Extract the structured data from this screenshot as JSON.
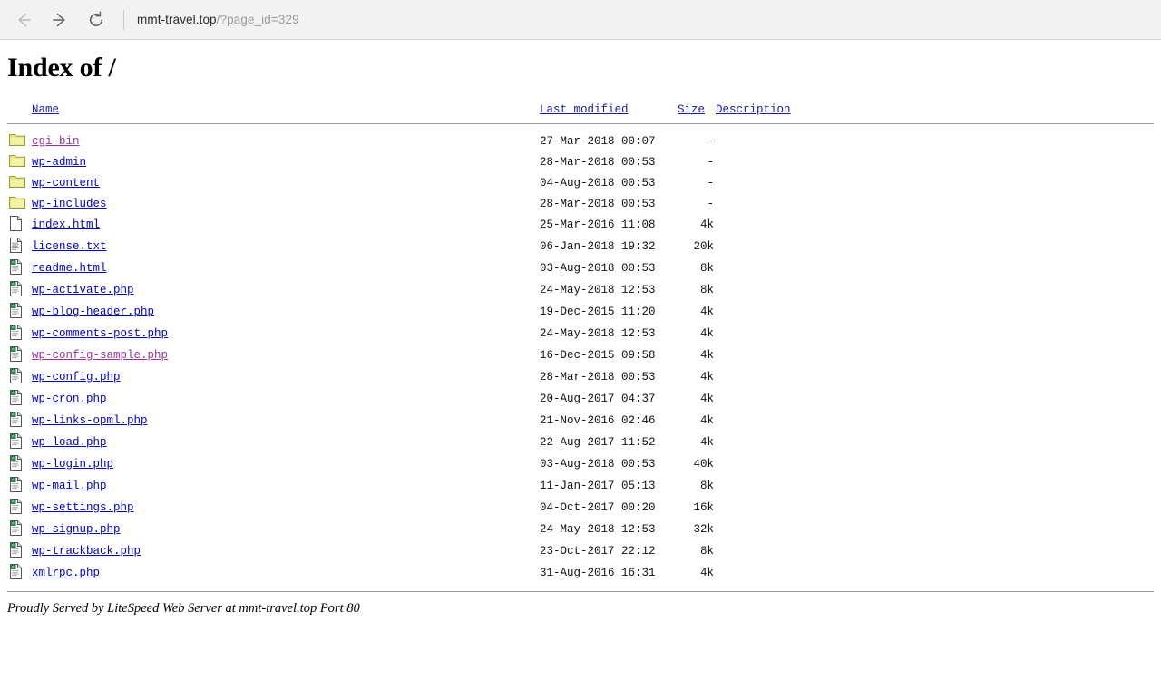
{
  "browser": {
    "back_icon": "arrow-left-icon",
    "forward_icon": "arrow-right-icon",
    "reload_icon": "reload-icon",
    "url_host": "mmt-travel.top",
    "url_path": "/?page_id=329"
  },
  "page": {
    "title": "Index of /",
    "columns": {
      "name": "Name",
      "last_modified": "Last modified",
      "size": "Size",
      "description": "Description "
    },
    "footer": "Proudly Served by LiteSpeed Web Server at mmt-travel.top Port 80"
  },
  "colors": {
    "link": "#0000cc",
    "visited_link": "#993399",
    "folder": "#efef9f",
    "rule": "#9a9a9a"
  },
  "entries": [
    {
      "icon": "folder-icon",
      "name": "cgi-bin",
      "modified": "27-Mar-2018 00:07",
      "size": "-",
      "visited": true
    },
    {
      "icon": "folder-icon",
      "name": "wp-admin",
      "modified": "28-Mar-2018 00:53",
      "size": "-",
      "visited": false
    },
    {
      "icon": "folder-icon",
      "name": "wp-content",
      "modified": "04-Aug-2018 00:53",
      "size": "-",
      "visited": false
    },
    {
      "icon": "folder-icon",
      "name": "wp-includes",
      "modified": "28-Mar-2018 00:53",
      "size": "-",
      "visited": false
    },
    {
      "icon": "blank-page-icon",
      "name": "index.html ",
      "modified": "25-Mar-2016 11:08",
      "size": "4k",
      "visited": false
    },
    {
      "icon": "text-file-icon",
      "name": "license.txt",
      "modified": "06-Jan-2018 19:32",
      "size": "20k",
      "visited": false
    },
    {
      "icon": "script-file-icon",
      "name": "readme.html",
      "modified": "03-Aug-2018 00:53",
      "size": "8k",
      "visited": false
    },
    {
      "icon": "script-file-icon",
      "name": "wp-activate.php",
      "modified": "24-May-2018 12:53",
      "size": "8k",
      "visited": false
    },
    {
      "icon": "script-file-icon",
      "name": "wp-blog-header.php",
      "modified": "19-Dec-2015 11:20",
      "size": "4k",
      "visited": false
    },
    {
      "icon": "script-file-icon",
      "name": "wp-comments-post.php",
      "modified": "24-May-2018 12:53",
      "size": "4k",
      "visited": false
    },
    {
      "icon": "script-file-icon",
      "name": "wp-config-sample.php",
      "modified": "16-Dec-2015 09:58",
      "size": "4k",
      "visited": true
    },
    {
      "icon": "script-file-icon",
      "name": "wp-config.php",
      "modified": "28-Mar-2018 00:53",
      "size": "4k",
      "visited": false
    },
    {
      "icon": "script-file-icon",
      "name": "wp-cron.php",
      "modified": "20-Aug-2017 04:37",
      "size": "4k",
      "visited": false
    },
    {
      "icon": "script-file-icon",
      "name": "wp-links-opml.php",
      "modified": "21-Nov-2016 02:46",
      "size": "4k",
      "visited": false
    },
    {
      "icon": "script-file-icon",
      "name": "wp-load.php",
      "modified": "22-Aug-2017 11:52",
      "size": "4k",
      "visited": false
    },
    {
      "icon": "script-file-icon",
      "name": "wp-login.php",
      "modified": "03-Aug-2018 00:53",
      "size": "40k",
      "visited": false
    },
    {
      "icon": "script-file-icon",
      "name": "wp-mail.php",
      "modified": "11-Jan-2017 05:13",
      "size": "8k",
      "visited": false
    },
    {
      "icon": "script-file-icon",
      "name": "wp-settings.php",
      "modified": "04-Oct-2017 00:20",
      "size": "16k",
      "visited": false
    },
    {
      "icon": "script-file-icon",
      "name": "wp-signup.php",
      "modified": "24-May-2018 12:53",
      "size": "32k",
      "visited": false
    },
    {
      "icon": "script-file-icon",
      "name": "wp-trackback.php",
      "modified": "23-Oct-2017 22:12",
      "size": "8k",
      "visited": false
    },
    {
      "icon": "script-file-icon",
      "name": "xmlrpc.php",
      "modified": "31-Aug-2016 16:31",
      "size": "4k",
      "visited": false
    }
  ]
}
